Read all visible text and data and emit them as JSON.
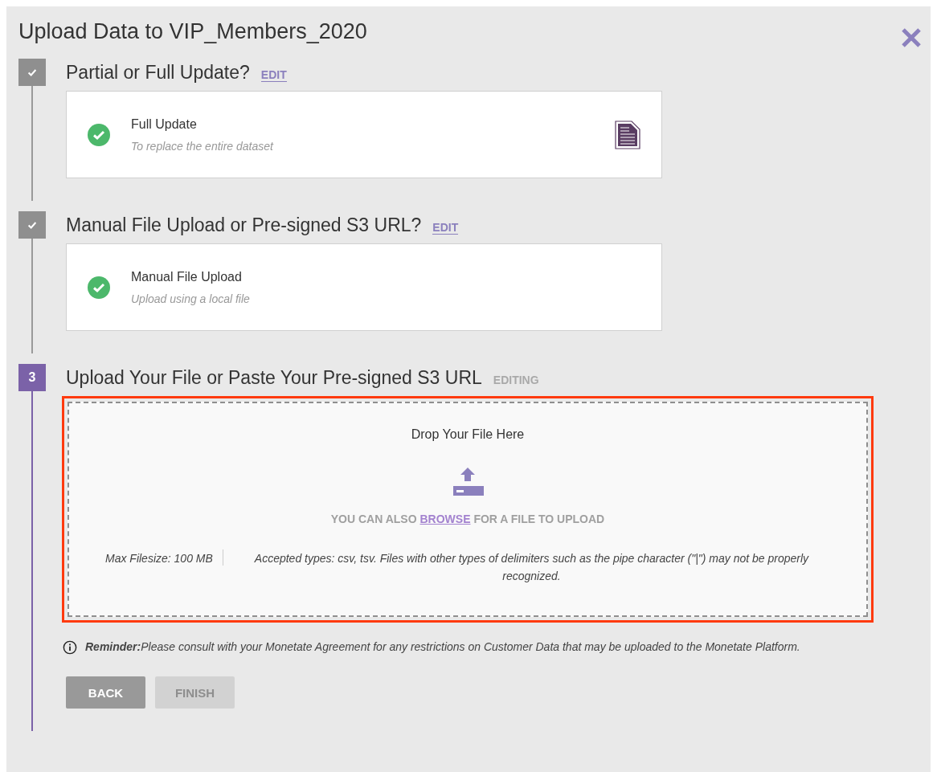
{
  "window": {
    "title": "Upload Data to VIP_Members_2020"
  },
  "steps": [
    {
      "kind": "done",
      "title": "Partial or Full Update?",
      "action": "EDIT",
      "card": {
        "title": "Full Update",
        "subtitle": "To replace the entire dataset",
        "file_icon": true
      }
    },
    {
      "kind": "done",
      "title": "Manual File Upload or Pre-signed S3 URL?",
      "action": "EDIT",
      "card": {
        "title": "Manual File Upload",
        "subtitle": "Upload using a local file",
        "file_icon": false
      }
    },
    {
      "kind": "current",
      "number": "3",
      "title": "Upload Your File or Paste Your Pre-signed S3 URL",
      "action": "EDITING"
    }
  ],
  "dropzone": {
    "title": "Drop Your File Here",
    "browse_before": "YOU CAN ALSO",
    "browse_link": "BROWSE",
    "browse_after": "FOR A FILE TO UPLOAD",
    "max_size": "Max Filesize: 100 MB",
    "accepted": "Accepted types: csv, tsv. Files with other types of delimiters such as the pipe character (\"|\") may not be properly recognized.",
    "highlighted": true
  },
  "reminder": "**Reminder:**Please consult with your Monetate Agreement for any restrictions on Customer Data that may be uploaded to the Monetate Platform.",
  "buttons": [
    {
      "label": "BACK",
      "disabled": false
    },
    {
      "label": "FINISH",
      "disabled": true
    }
  ]
}
